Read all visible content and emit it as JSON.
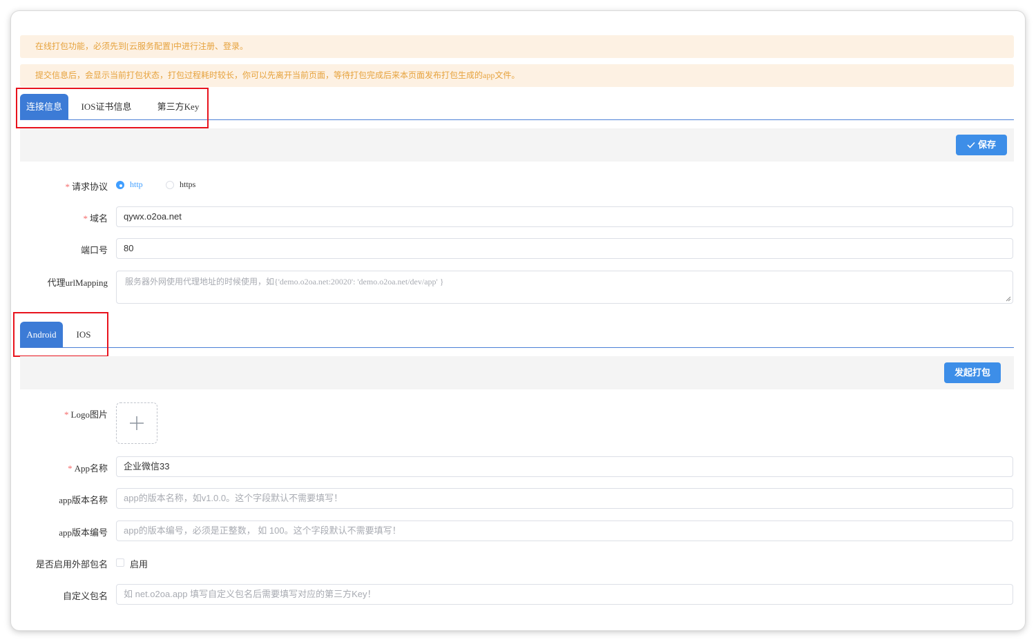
{
  "notices": [
    "在线打包功能，必须先到[云服务配置]中进行注册、登录。",
    "提交信息后，会显示当前打包状态，打包过程耗时较长，你可以先离开当前页面，等待打包完成后来本页面发布打包生成的app文件。"
  ],
  "config_tabs": [
    {
      "label": "连接信息",
      "active": true
    },
    {
      "label": "IOS证书信息",
      "active": false
    },
    {
      "label": "第三方Key",
      "active": false
    }
  ],
  "save_button": {
    "icon": "check-icon",
    "label": "保存"
  },
  "protocol": {
    "label": "请求协议",
    "options": [
      {
        "label": "http",
        "selected": true
      },
      {
        "label": "https",
        "selected": false
      }
    ]
  },
  "domain": {
    "label": "域名",
    "value": "qywx.o2oa.net"
  },
  "port": {
    "label": "端口号",
    "value": "80"
  },
  "proxy": {
    "label": "代理urlMapping",
    "placeholder": "服务器外网使用代理地址的时候使用，如{'demo.o2oa.net:20020': 'demo.o2oa.net/dev/app' }"
  },
  "platform_tabs": [
    {
      "label": "Android",
      "active": true
    },
    {
      "label": "IOS",
      "active": false
    }
  ],
  "package_button": {
    "label": "发起打包"
  },
  "logo": {
    "label": "Logo图片",
    "icon": "plus-icon"
  },
  "app_name": {
    "label": "App名称",
    "value": "企业微信33"
  },
  "version_name": {
    "label": "app版本名称",
    "placeholder": "app的版本名称，如v1.0.0。这个字段默认不需要填写！"
  },
  "version_code": {
    "label": "app版本编号",
    "placeholder": "app的版本编号，必须是正整数， 如 100。这个字段默认不需要填写！"
  },
  "external_package": {
    "label": "是否启用外部包名",
    "option_label": "启用",
    "checked": false
  },
  "custom_package": {
    "label": "自定义包名",
    "placeholder": "如 net.o2oa.app 填写自定义包名后需要填写对应的第三方Key！"
  },
  "colors": {
    "accent": "#3c7bd6",
    "button": "#3d8ee8",
    "warning_bg": "#fdf1e3",
    "warning_text": "#e6a23c",
    "highlight": "#e8121c"
  }
}
